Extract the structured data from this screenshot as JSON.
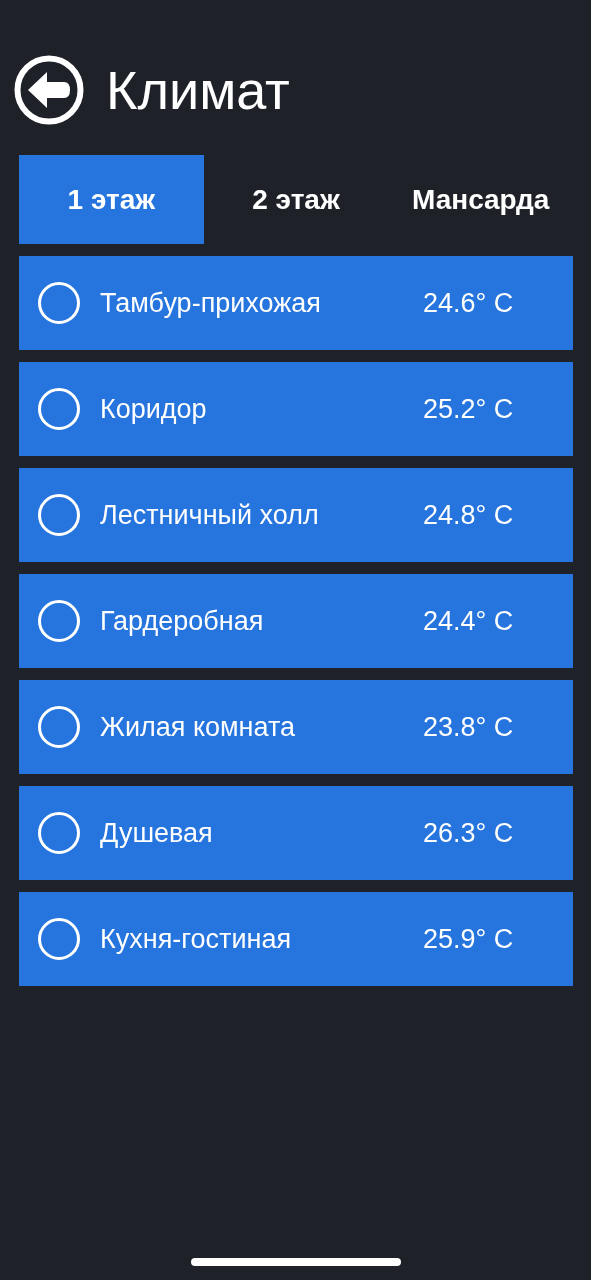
{
  "header": {
    "title": "Климат"
  },
  "tabs": [
    {
      "label": "1 этаж",
      "selected": true
    },
    {
      "label": "2 этаж",
      "selected": false
    },
    {
      "label": "Мансарда",
      "selected": false
    }
  ],
  "rooms": [
    {
      "name": "Тамбур-прихожая",
      "temperature": "24.6° C",
      "on": false
    },
    {
      "name": "Коридор",
      "temperature": "25.2° C",
      "on": false
    },
    {
      "name": "Лестничный холл",
      "temperature": "24.8° C",
      "on": false
    },
    {
      "name": "Гардеробная",
      "temperature": "24.4° C",
      "on": false
    },
    {
      "name": "Жилая комната",
      "temperature": "23.8° C",
      "on": false
    },
    {
      "name": "Душевая",
      "temperature": "26.3° C",
      "on": false
    },
    {
      "name": "Кухня-гостиная",
      "temperature": "25.9° C",
      "on": false
    }
  ]
}
